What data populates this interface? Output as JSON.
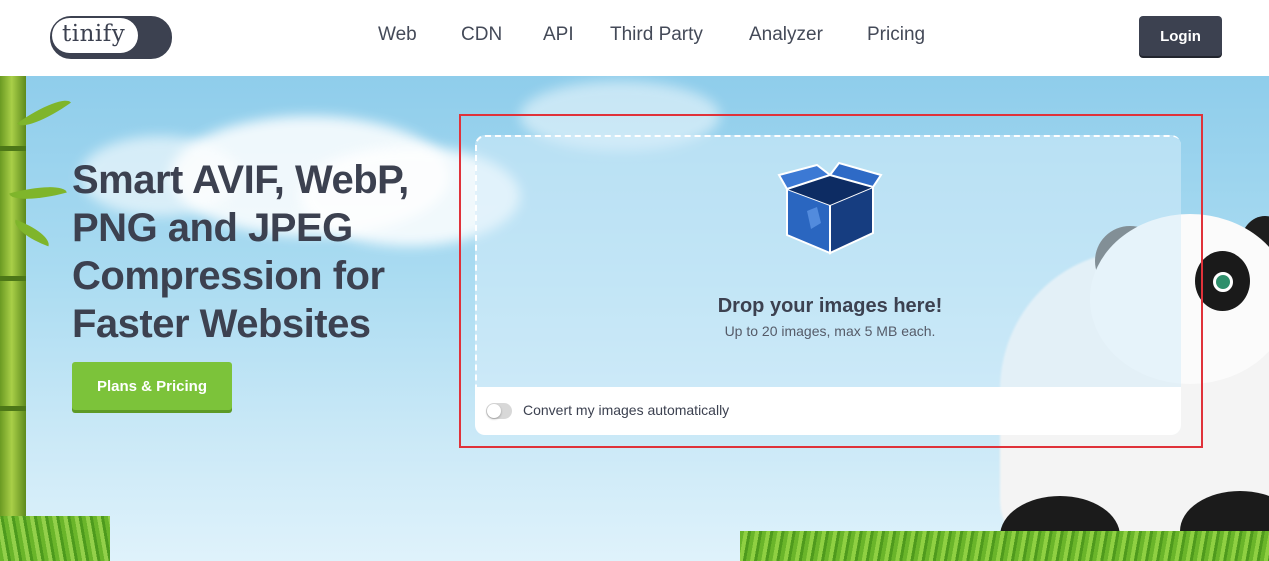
{
  "header": {
    "logo_text": "tinify",
    "nav": [
      {
        "label": "Web"
      },
      {
        "label": "CDN"
      },
      {
        "label": "API"
      },
      {
        "label": "Third Party"
      },
      {
        "label": "Analyzer"
      },
      {
        "label": "Pricing"
      }
    ],
    "login_label": "Login"
  },
  "hero": {
    "headline_lines": [
      "Smart AVIF, WebP,",
      "PNG and JPEG",
      "Compression for",
      "Faster Websites"
    ],
    "cta_label": "Plans & Pricing"
  },
  "upload": {
    "title": "Drop your images here!",
    "subtitle": "Up to 20 images, max 5 MB each.",
    "convert_toggle_label": "Convert my images automatically",
    "convert_toggle_on": false
  },
  "colors": {
    "brand_dark": "#3c4150",
    "cta_green": "#7cc33a",
    "highlight_red": "#e0323a",
    "box_blue": "#1f55a8"
  }
}
